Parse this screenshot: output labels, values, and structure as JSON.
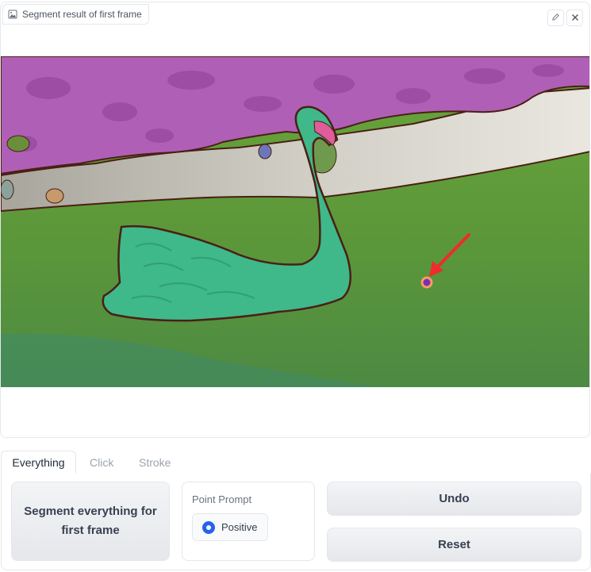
{
  "image_panel": {
    "label": "Segment result of first frame",
    "label_icon": "image-icon",
    "actions": [
      {
        "name": "edit-icon"
      },
      {
        "name": "close-icon"
      }
    ],
    "image_description": "Segmented swan on water with colored masks and a clicked point marker"
  },
  "tabs": [
    {
      "label": "Everything",
      "active": true
    },
    {
      "label": "Click",
      "active": false
    },
    {
      "label": "Stroke",
      "active": false
    }
  ],
  "everything_panel": {
    "segment_button": "Segment everything for first frame",
    "point_prompt": {
      "title": "Point Prompt",
      "option": "Positive",
      "selected": true
    },
    "undo_button": "Undo",
    "reset_button": "Reset"
  },
  "colors": {
    "accent": "#2563eb",
    "swan_mask": "#3fb88a",
    "background_mask": "#b05fb6",
    "water_mask": "#6aa53a",
    "point_marker": "#7b2cbf",
    "arrow": "#ef2b2b"
  }
}
